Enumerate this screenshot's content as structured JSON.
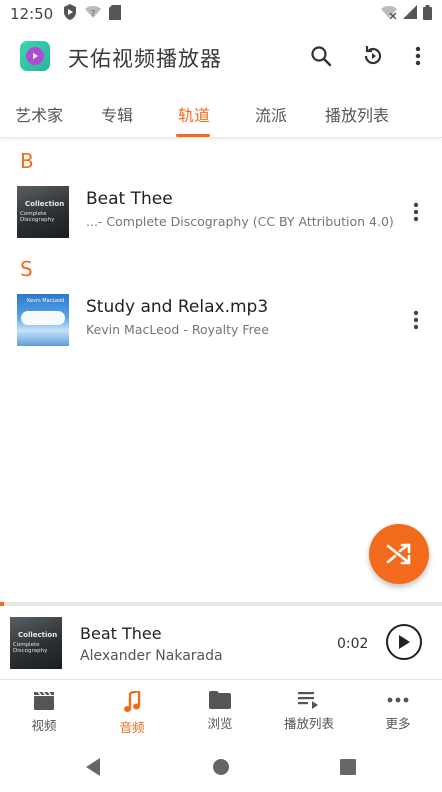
{
  "status_bar": {
    "time": "12:50",
    "icons_left": [
      "play-protect-icon",
      "wifi-icon",
      "sd-card-icon"
    ],
    "icons_right": [
      "wifi-off-icon",
      "signal-icon",
      "battery-icon"
    ]
  },
  "app_bar": {
    "title": "天佑视频播放器",
    "actions": [
      "search-icon",
      "history-icon",
      "more-vertical-icon"
    ]
  },
  "tabs": [
    {
      "label": "艺术家",
      "active": false
    },
    {
      "label": "专辑",
      "active": false
    },
    {
      "label": "轨道",
      "active": true
    },
    {
      "label": "流派",
      "active": false
    },
    {
      "label": "播放列表",
      "active": false
    }
  ],
  "sections": [
    {
      "letter": "B",
      "tracks": [
        {
          "title": "Beat Thee",
          "subtitle": "...- Complete Discography (CC BY Attribution 4.0)",
          "cover": "Collection / Complete Discography"
        }
      ]
    },
    {
      "letter": "S",
      "tracks": [
        {
          "title": "Study and Relax.mp3",
          "subtitle": "Kevin MacLeod - Royalty Free",
          "cover": "Kevin MacLeod"
        }
      ]
    }
  ],
  "fab": {
    "icon": "shuffle-icon"
  },
  "mini_player": {
    "title": "Beat Thee",
    "artist": "Alexander Nakarada",
    "time": "0:02",
    "progress_percent": 1,
    "cover_line1": "Collection",
    "cover_line2": "Complete Discography"
  },
  "bottom_nav": [
    {
      "label": "视频",
      "icon": "movie-icon",
      "active": false
    },
    {
      "label": "音频",
      "icon": "music-note-icon",
      "active": true
    },
    {
      "label": "浏览",
      "icon": "folder-icon",
      "active": false
    },
    {
      "label": "播放列表",
      "icon": "playlist-icon",
      "active": false
    },
    {
      "label": "更多",
      "icon": "more-horizontal-icon",
      "active": false
    }
  ],
  "colors": {
    "accent": "#f26b1d",
    "text": "#212121",
    "secondary_text": "#757575"
  }
}
